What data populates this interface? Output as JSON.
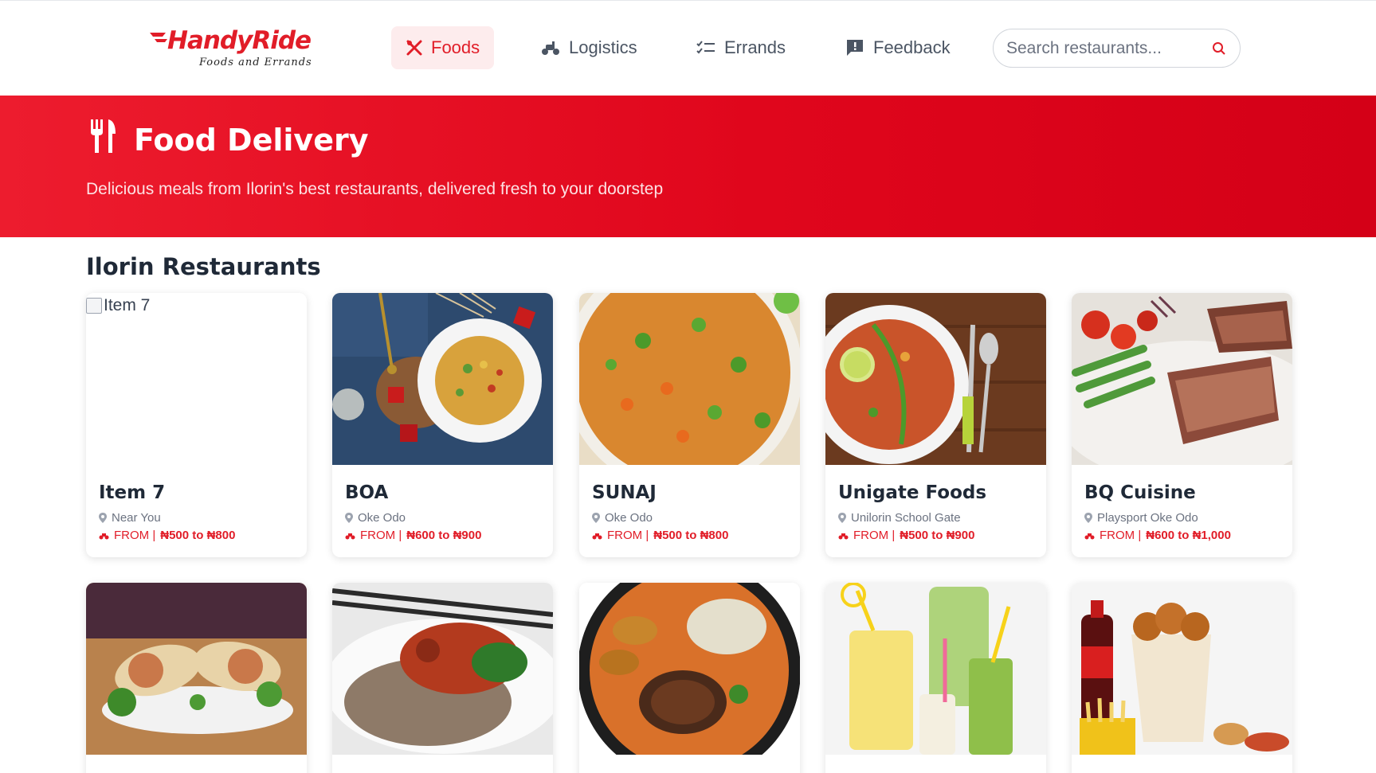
{
  "header": {
    "logo": {
      "brand": "HandyRide",
      "tagline": "Foods and Errands"
    },
    "nav": [
      {
        "label": "Foods",
        "icon": "fork-knife-cross-icon",
        "active": true
      },
      {
        "label": "Logistics",
        "icon": "scooter-icon",
        "active": false
      },
      {
        "label": "Errands",
        "icon": "checklist-icon",
        "active": false
      },
      {
        "label": "Feedback",
        "icon": "feedback-icon",
        "active": false
      }
    ],
    "search": {
      "placeholder": "Search restaurants..."
    }
  },
  "banner": {
    "title": "Food Delivery",
    "subtitle": "Delicious meals from Ilorin's best restaurants, delivered fresh to your doorstep",
    "icon": "utensils-icon"
  },
  "section": {
    "title": "Ilorin Restaurants"
  },
  "restaurants": [
    {
      "name": "Item 7",
      "image_alt": "Item 7",
      "location": "Near You",
      "price_prefix": "FROM |",
      "price": "₦500 to ₦800"
    },
    {
      "name": "BOA",
      "location": "Oke Odo",
      "price_prefix": "FROM |",
      "price": "₦600 to ₦900"
    },
    {
      "name": "SUNAJ",
      "location": "Oke Odo",
      "price_prefix": "FROM |",
      "price": "₦500 to ₦800"
    },
    {
      "name": "Unigate Foods",
      "location": "Unilorin School Gate",
      "price_prefix": "FROM |",
      "price": "₦500 to ₦900"
    },
    {
      "name": "BQ Cuisine",
      "location": "Playsport Oke Odo",
      "price_prefix": "FROM |",
      "price": "₦600 to ₦1,000"
    }
  ],
  "colors": {
    "accent": "#e11d28",
    "banner": "#e0061c",
    "nav_active_bg": "#fdeced"
  }
}
